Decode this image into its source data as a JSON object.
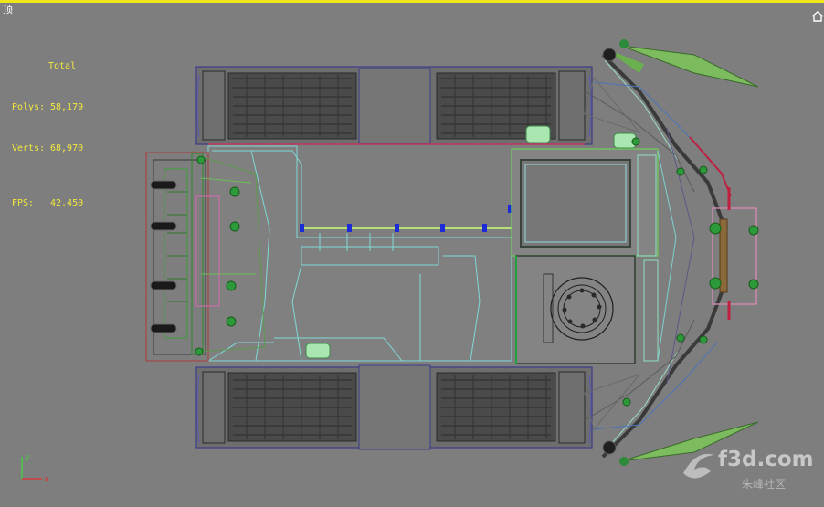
{
  "viewport": {
    "label": "顶",
    "accent_color": "#f2e61a",
    "background_color": "#7e7e7e"
  },
  "stats": {
    "total_label": "Total",
    "polys_label": "Polys:",
    "polys_value": "58,179",
    "verts_label": "Verts:",
    "verts_value": "68,970",
    "fps_label": "FPS:",
    "fps_value": "42.450"
  },
  "axis": {
    "y_label": "y",
    "x_label": "x"
  },
  "watermark": {
    "text": "f3d.com",
    "subtext": "朱峰社区"
  },
  "icons": {
    "viewcube": "house-icon",
    "axis": "axis-tripod-icon"
  }
}
